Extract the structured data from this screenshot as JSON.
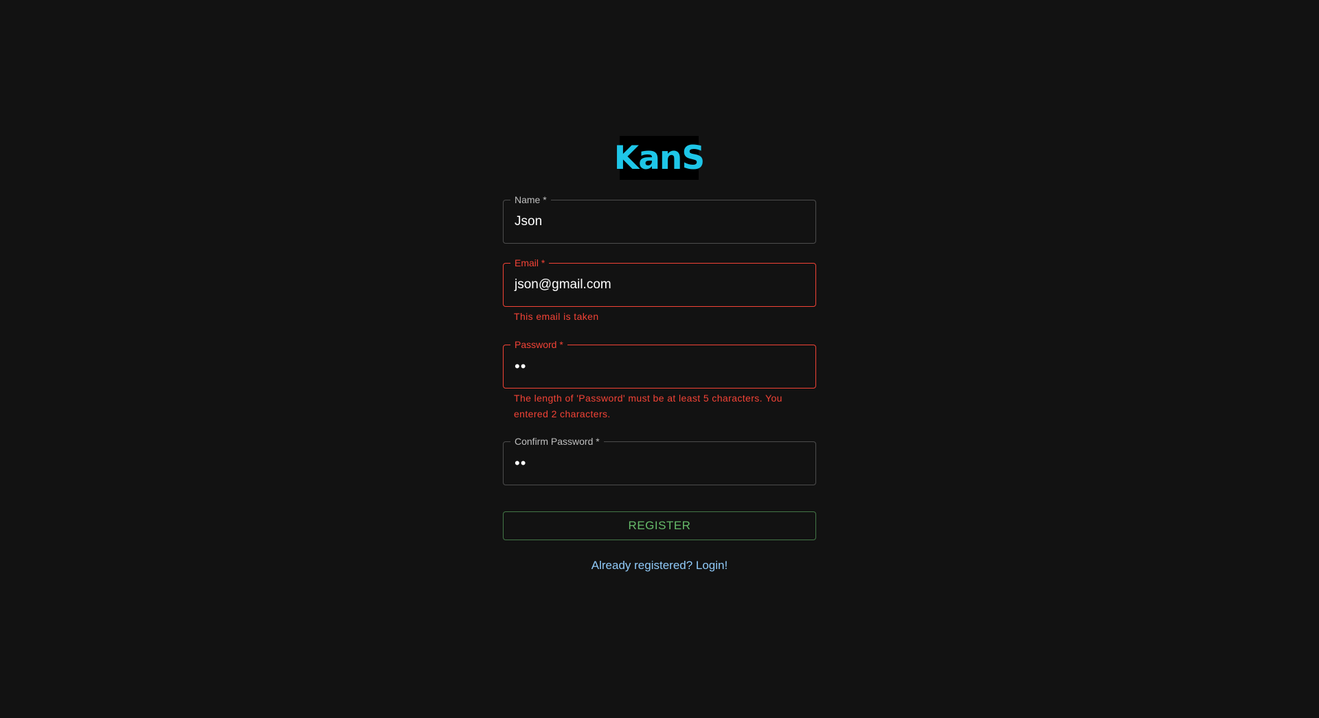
{
  "logo": {
    "text": "KanS",
    "color": "#1ec6e8"
  },
  "form": {
    "name": {
      "label": "Name *",
      "value": "Json"
    },
    "email": {
      "label": "Email *",
      "value": "json@gmail.com",
      "error": "This email is taken"
    },
    "password": {
      "label": "Password *",
      "value": "••",
      "error": "The length of 'Password' must be at least 5 characters. You entered 2 characters."
    },
    "confirm_password": {
      "label": "Confirm Password *",
      "value": "••"
    },
    "register_label": "REGISTER",
    "login_link": "Already registered? Login!"
  },
  "colors": {
    "background": "#121212",
    "error": "#f44336",
    "success": "#66bb6a",
    "link": "#90caf9"
  }
}
